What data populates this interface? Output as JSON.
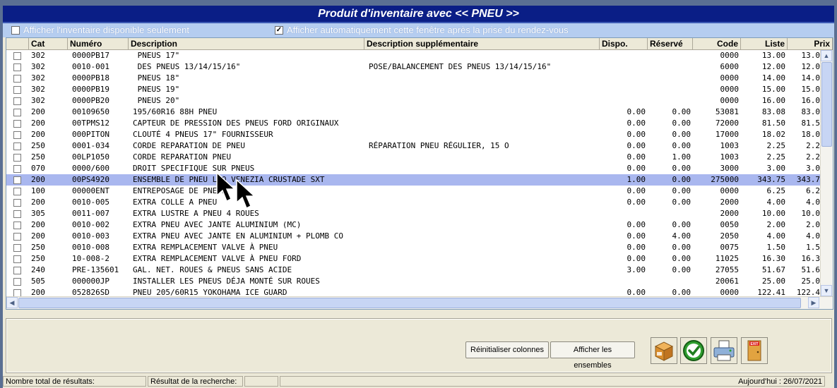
{
  "window": {
    "title": "Produit d'inventaire avec << PNEU >>"
  },
  "options": {
    "available_only": {
      "label": "Afficher l'inventaire disponible seulement",
      "checked": false
    },
    "auto_show": {
      "label": "Afficher automatiquement cette fenêtre après la prise du rendez-vous",
      "checked": true,
      "mark": "✓"
    }
  },
  "columns": [
    "Cat",
    "Numéro",
    "Description",
    "Description supplémentaire",
    "Dispo.",
    "Réservé",
    "Code",
    "Liste",
    "Prix"
  ],
  "rows": [
    {
      "cat": "302",
      "num": "0000PB17",
      "desc": " PNEUS 17\"",
      "desc2": "",
      "dispo": "",
      "reserve": "",
      "code": "0000",
      "liste": "13.00",
      "prix": "13.0"
    },
    {
      "cat": "302",
      "num": "0010-001",
      "desc": " DES PNEUS 13/14/15/16\"",
      "desc2": "POSE/BALANCEMENT DES PNEUS 13/14/15/16\"",
      "dispo": "",
      "reserve": "",
      "code": "6000",
      "liste": "12.00",
      "prix": "12.0"
    },
    {
      "cat": "302",
      "num": "0000PB18",
      "desc": " PNEUS 18\"",
      "desc2": "",
      "dispo": "",
      "reserve": "",
      "code": "0000",
      "liste": "14.00",
      "prix": "14.0"
    },
    {
      "cat": "302",
      "num": "0000PB19",
      "desc": " PNEUS 19\"",
      "desc2": "",
      "dispo": "",
      "reserve": "",
      "code": "0000",
      "liste": "15.00",
      "prix": "15.0"
    },
    {
      "cat": "302",
      "num": "0000PB20",
      "desc": " PNEUS 20\"",
      "desc2": "",
      "dispo": "",
      "reserve": "",
      "code": "0000",
      "liste": "16.00",
      "prix": "16.0"
    },
    {
      "cat": "200",
      "num": "00109650",
      "desc": "195/60R16 88H PNEU",
      "desc2": "",
      "dispo": "0.00",
      "reserve": "0.00",
      "code": "53081",
      "liste": "83.08",
      "prix": "83.0"
    },
    {
      "cat": "200",
      "num": "00TPMS12",
      "desc": "CAPTEUR DE PRESSION DES PNEUS FORD ORIGINAUX",
      "desc2": "",
      "dispo": "0.00",
      "reserve": "0.00",
      "code": "72000",
      "liste": "81.50",
      "prix": "81.5"
    },
    {
      "cat": "200",
      "num": "000PITON",
      "desc": "CLOUTÉ 4 PNEUS 17\" FOURNISSEUR",
      "desc2": "",
      "dispo": "0.00",
      "reserve": "0.00",
      "code": "17000",
      "liste": "18.02",
      "prix": "18.0"
    },
    {
      "cat": "250",
      "num": "0001-034",
      "desc": "CORDE REPARATION DE PNEU",
      "desc2": "RÉPARATION PNEU RÉGULIER, 15 O",
      "dispo": "0.00",
      "reserve": "0.00",
      "code": "1003",
      "liste": "2.25",
      "prix": "2.2"
    },
    {
      "cat": "250",
      "num": "00LP1050",
      "desc": "CORDE REPARATION PNEU",
      "desc2": "",
      "dispo": "0.00",
      "reserve": "1.00",
      "code": "1003",
      "liste": "2.25",
      "prix": "2.2"
    },
    {
      "cat": "070",
      "num": "0000/600",
      "desc": "DROIT SPECIFIQUE SUR PNEUS",
      "desc2": "",
      "dispo": "0.00",
      "reserve": "0.00",
      "code": "3000",
      "liste": "3.00",
      "prix": "3.0"
    },
    {
      "cat": "200",
      "num": "00PS4920",
      "desc": "ENSEMBLE DE PNEU LKQ VENEZIA CRUSTADE SXT",
      "desc2": "",
      "dispo": "1.00",
      "reserve": "0.00",
      "code": "275000",
      "liste": "343.75",
      "prix": "343.7",
      "selected": true
    },
    {
      "cat": "100",
      "num": "00000ENT",
      "desc": "ENTREPOSAGE DE PNEUS",
      "desc2": "",
      "dispo": "0.00",
      "reserve": "0.00",
      "code": "0000",
      "liste": "6.25",
      "prix": "6.2"
    },
    {
      "cat": "200",
      "num": "0010-005",
      "desc": "EXTRA COLLE A PNEU",
      "desc2": "",
      "dispo": "0.00",
      "reserve": "0.00",
      "code": "2000",
      "liste": "4.00",
      "prix": "4.0"
    },
    {
      "cat": "305",
      "num": "0011-007",
      "desc": "EXTRA LUSTRE A PNEU 4 ROUES",
      "desc2": "",
      "dispo": "",
      "reserve": "",
      "code": "2000",
      "liste": "10.00",
      "prix": "10.0"
    },
    {
      "cat": "200",
      "num": "0010-002",
      "desc": "EXTRA PNEU AVEC JANTE ALUMINIUM (MC)",
      "desc2": "",
      "dispo": "0.00",
      "reserve": "0.00",
      "code": "0050",
      "liste": "2.00",
      "prix": "2.0"
    },
    {
      "cat": "200",
      "num": "0010-003",
      "desc": "EXTRA PNEU AVEC JANTE EN ALUMINIUM + PLOMB CO",
      "desc2": "",
      "dispo": "0.00",
      "reserve": "4.00",
      "code": "2050",
      "liste": "4.00",
      "prix": "4.0"
    },
    {
      "cat": "250",
      "num": "0010-008",
      "desc": "EXTRA REMPLACEMENT VALVE À PNEU",
      "desc2": "",
      "dispo": "0.00",
      "reserve": "0.00",
      "code": "0075",
      "liste": "1.50",
      "prix": "1.5"
    },
    {
      "cat": "250",
      "num": "10-008-2",
      "desc": "EXTRA REMPLACEMENT VALVE À PNEU FORD",
      "desc2": "",
      "dispo": "0.00",
      "reserve": "0.00",
      "code": "11025",
      "liste": "16.30",
      "prix": "16.3"
    },
    {
      "cat": "240",
      "num": "PRE-135601",
      "desc": "GAL. NET. ROUES & PNEUS SANS ACIDE",
      "desc2": "",
      "dispo": "3.00",
      "reserve": "0.00",
      "code": "27055",
      "liste": "51.67",
      "prix": "51.6"
    },
    {
      "cat": "505",
      "num": "000000JP",
      "desc": "INSTALLER LES PNEUS DÉJA MONTÉ SUR ROUES",
      "desc2": "",
      "dispo": "",
      "reserve": "",
      "code": "20061",
      "liste": "25.00",
      "prix": "25.0"
    },
    {
      "cat": "200",
      "num": "052826SD",
      "desc": "PNEU 205/60R15 YOKOHAMA ICE GUARD",
      "desc2": "",
      "dispo": "0.00",
      "reserve": "0.00",
      "code": "0000",
      "liste": "122.41",
      "prix": "122.4"
    }
  ],
  "buttons": {
    "reset_columns": "Réinitialiser colonnes",
    "show_sets": "Afficher les ensembles"
  },
  "icons": {
    "box": "package-icon",
    "accept": "green-check-icon",
    "print": "printer-icon",
    "exit": "exit-door-icon",
    "exit_text": "EXIT"
  },
  "status": {
    "total_label": "Nombre total de résultats:",
    "search_label": "Résultat de la recherche:",
    "today": "Aujourd'hui : 26/07/2021"
  },
  "scroll_glyphs": {
    "up": "▲",
    "down": "▼",
    "left": "◀",
    "right": "▶"
  }
}
